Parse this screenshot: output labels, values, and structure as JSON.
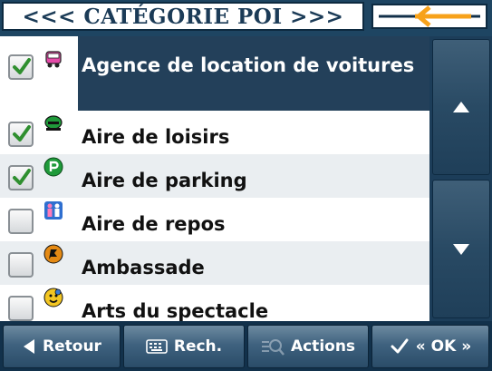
{
  "header": {
    "title": "<<< CATÉGORIE POI >>>",
    "back_icon": "arrow-left-icon",
    "accent_color": "#f7a21b"
  },
  "list": {
    "items": [
      {
        "label": "Agence de location de voitures",
        "checked": true,
        "icon": "car-rental-icon",
        "selected": true
      },
      {
        "label": "Aire de loisirs",
        "checked": true,
        "icon": "leisure-area-icon",
        "selected": false
      },
      {
        "label": "Aire de parking",
        "checked": true,
        "icon": "parking-icon",
        "selected": false
      },
      {
        "label": "Aire de repos",
        "checked": false,
        "icon": "rest-area-icon",
        "selected": false
      },
      {
        "label": "Ambassade",
        "checked": false,
        "icon": "embassy-icon",
        "selected": false
      },
      {
        "label": "Arts du spectacle",
        "checked": false,
        "icon": "theater-masks-icon",
        "selected": false
      }
    ]
  },
  "scroll": {
    "up_icon": "triangle-up-icon",
    "down_icon": "triangle-down-icon"
  },
  "footer": {
    "back_label": "Retour",
    "search_label": "Rech.",
    "actions_label": "Actions",
    "ok_label": "« OK »"
  }
}
